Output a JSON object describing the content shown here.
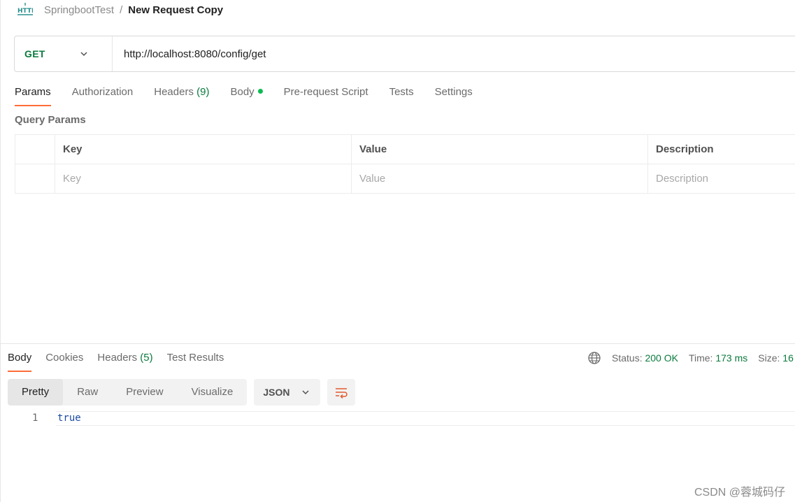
{
  "breadcrumb": {
    "icon": "http-icon",
    "parent": "SpringbootTest",
    "separator": "/",
    "current": "New Request Copy"
  },
  "request": {
    "method": "GET",
    "url": "http://localhost:8080/config/get"
  },
  "request_tabs": [
    {
      "label": "Params",
      "active": true
    },
    {
      "label": "Authorization"
    },
    {
      "label": "Headers",
      "count": "(9)"
    },
    {
      "label": "Body",
      "indicator": "green-dot"
    },
    {
      "label": "Pre-request Script"
    },
    {
      "label": "Tests"
    },
    {
      "label": "Settings"
    }
  ],
  "query_params": {
    "title": "Query Params",
    "columns": [
      "Key",
      "Value",
      "Description"
    ],
    "placeholders": [
      "Key",
      "Value",
      "Description"
    ]
  },
  "response_tabs": [
    {
      "label": "Body",
      "active": true
    },
    {
      "label": "Cookies"
    },
    {
      "label": "Headers",
      "count": "(5)"
    },
    {
      "label": "Test Results"
    }
  ],
  "status": {
    "status_label": "Status:",
    "status_value": "200 OK",
    "time_label": "Time:",
    "time_value": "173 ms",
    "size_label": "Size:",
    "size_value": "16"
  },
  "view_modes": [
    "Pretty",
    "Raw",
    "Preview",
    "Visualize"
  ],
  "format": "JSON",
  "response_body": {
    "line_number": "1",
    "text": "true"
  },
  "watermark": "CSDN @蓉城码仔",
  "colors": {
    "accent": "#ff6c37",
    "method_green": "#0b7a3e",
    "dot_green": "#0cbb52",
    "json_text": "#1b4aa3"
  }
}
